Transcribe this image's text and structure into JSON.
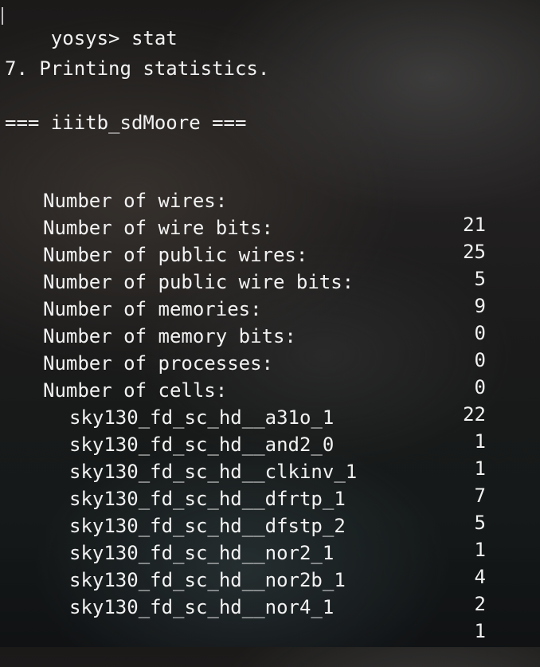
{
  "prompt": {
    "text": "yosys> ",
    "command": "stat"
  },
  "section_heading": "7. Printing statistics.",
  "module_heading": "=== iiitb_sdMoore ===",
  "stats": [
    {
      "label": "Number of wires:",
      "value": "21"
    },
    {
      "label": "Number of wire bits:",
      "value": "25"
    },
    {
      "label": "Number of public wires:",
      "value": "5"
    },
    {
      "label": "Number of public wire bits:",
      "value": "9"
    },
    {
      "label": "Number of memories:",
      "value": "0"
    },
    {
      "label": "Number of memory bits:",
      "value": "0"
    },
    {
      "label": "Number of processes:",
      "value": "0"
    },
    {
      "label": "Number of cells:",
      "value": "22"
    }
  ],
  "cells": [
    {
      "name": "sky130_fd_sc_hd__a31o_1",
      "count": "1"
    },
    {
      "name": "sky130_fd_sc_hd__and2_0",
      "count": "1"
    },
    {
      "name": "sky130_fd_sc_hd__clkinv_1",
      "count": "7"
    },
    {
      "name": "sky130_fd_sc_hd__dfrtp_1",
      "count": "5"
    },
    {
      "name": "sky130_fd_sc_hd__dfstp_2",
      "count": "1"
    },
    {
      "name": "sky130_fd_sc_hd__nor2_1",
      "count": "4"
    },
    {
      "name": "sky130_fd_sc_hd__nor2b_1",
      "count": "2"
    },
    {
      "name": "sky130_fd_sc_hd__nor4_1",
      "count": "1"
    }
  ]
}
